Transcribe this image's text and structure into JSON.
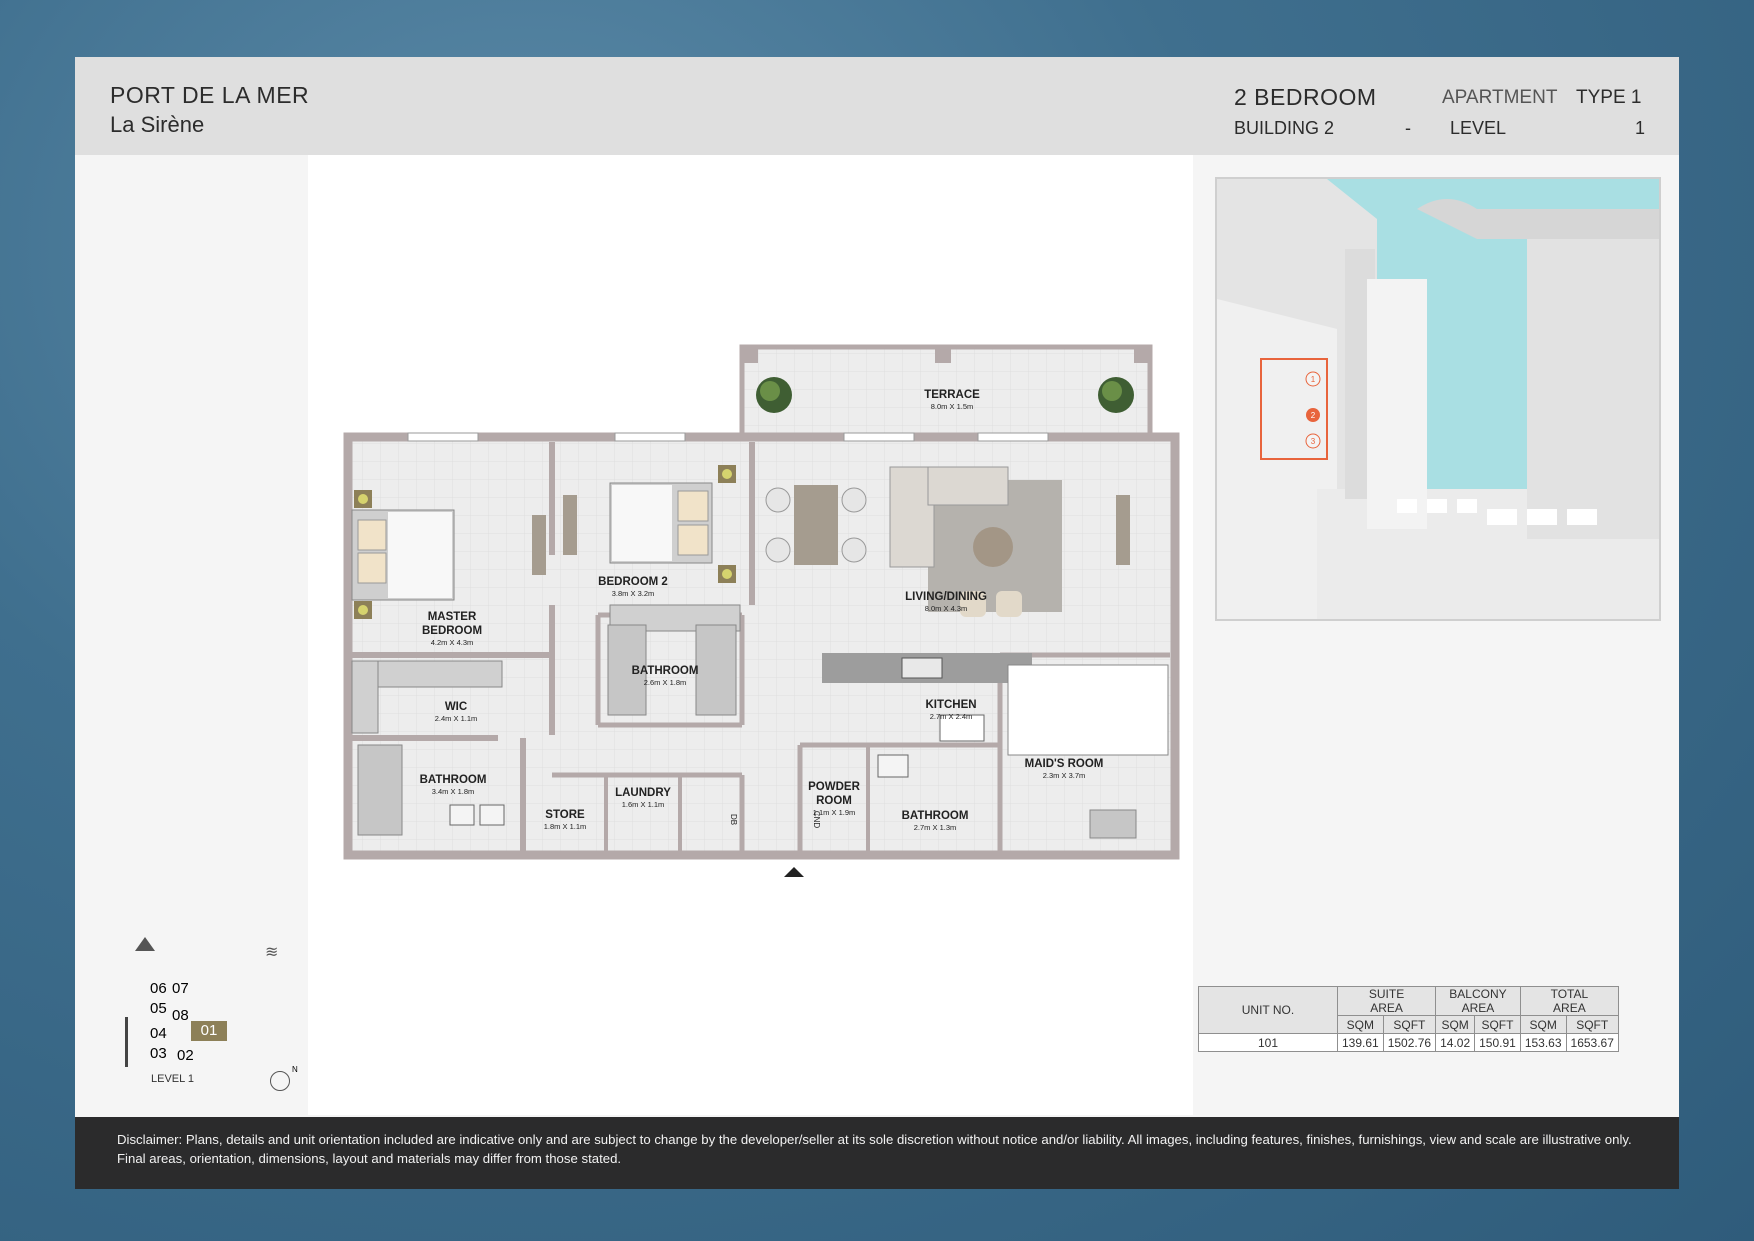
{
  "header": {
    "project": "PORT DE LA MER",
    "building_name": "La Sirène",
    "unit_type": "2 BEDROOM",
    "apartment_label": "APARTMENT",
    "type_label": "TYPE 1",
    "building": "BUILDING 2",
    "separator": "-",
    "level_label": "LEVEL",
    "level_value": "1"
  },
  "rooms": {
    "terrace": {
      "name": "TERRACE",
      "dims": "8.0m X 1.5m"
    },
    "master_bedroom": {
      "name": "MASTER BEDROOM",
      "dims": "4.2m X 4.3m"
    },
    "bedroom2": {
      "name": "BEDROOM 2",
      "dims": "3.8m X 3.2m"
    },
    "living": {
      "name": "LIVING/DINING",
      "dims": "8.0m X 4.3m"
    },
    "bathroom2": {
      "name": "BATHROOM",
      "dims": "2.6m X 1.8m"
    },
    "wic": {
      "name": "WIC",
      "dims": "2.4m X 1.1m"
    },
    "kitchen": {
      "name": "KITCHEN",
      "dims": "2.7m X 2.4m"
    },
    "master_bath": {
      "name": "BATHROOM",
      "dims": "3.4m X 1.8m"
    },
    "store": {
      "name": "STORE",
      "dims": "1.8m X 1.1m"
    },
    "laundry": {
      "name": "LAUNDRY",
      "dims": "1.6m X 1.1m"
    },
    "powder": {
      "name": "POWDER ROOM",
      "dims": "1.1m X 1.9m"
    },
    "maid_bath": {
      "name": "BATHROOM",
      "dims": "2.7m X 1.3m"
    },
    "maids_room": {
      "name": "MAID'S ROOM",
      "dims": "2.3m X 3.7m"
    },
    "db": "DB",
    "cnd": "CND"
  },
  "site_plan": {
    "buildings": [
      "1",
      "2",
      "3"
    ],
    "highlighted": "2",
    "water_color": "#a9dfe3",
    "highlight_color": "#e8643c"
  },
  "key_plan": {
    "units": [
      "06",
      "07",
      "05",
      "08",
      "04",
      "01",
      "03",
      "02"
    ],
    "selected_unit": "01",
    "level": "LEVEL 1",
    "north": "N"
  },
  "area_table": {
    "unit_no_label": "UNIT NO.",
    "groups": [
      "SUITE AREA",
      "BALCONY AREA",
      "TOTAL AREA"
    ],
    "suite_line1": "SUITE",
    "suite_line2": "AREA",
    "balcony_line1": "BALCONY",
    "balcony_line2": "AREA",
    "total_line1": "TOTAL",
    "total_line2": "AREA",
    "sqm": "SQM",
    "sqft": "SQFT",
    "unit": "101",
    "suite_sqm": "139.61",
    "suite_sqft": "1502.76",
    "balcony_sqm": "14.02",
    "balcony_sqft": "150.91",
    "total_sqm": "153.63",
    "total_sqft": "1653.67"
  },
  "disclaimer": "Disclaimer: Plans, details and unit orientation included are indicative only and are subject to change by the developer/seller at its sole discretion without notice and/or liability. All images, including features, finishes, furnishings, view and scale are illustrative only. Final areas, orientation, dimensions, layout and materials may differ from those stated."
}
